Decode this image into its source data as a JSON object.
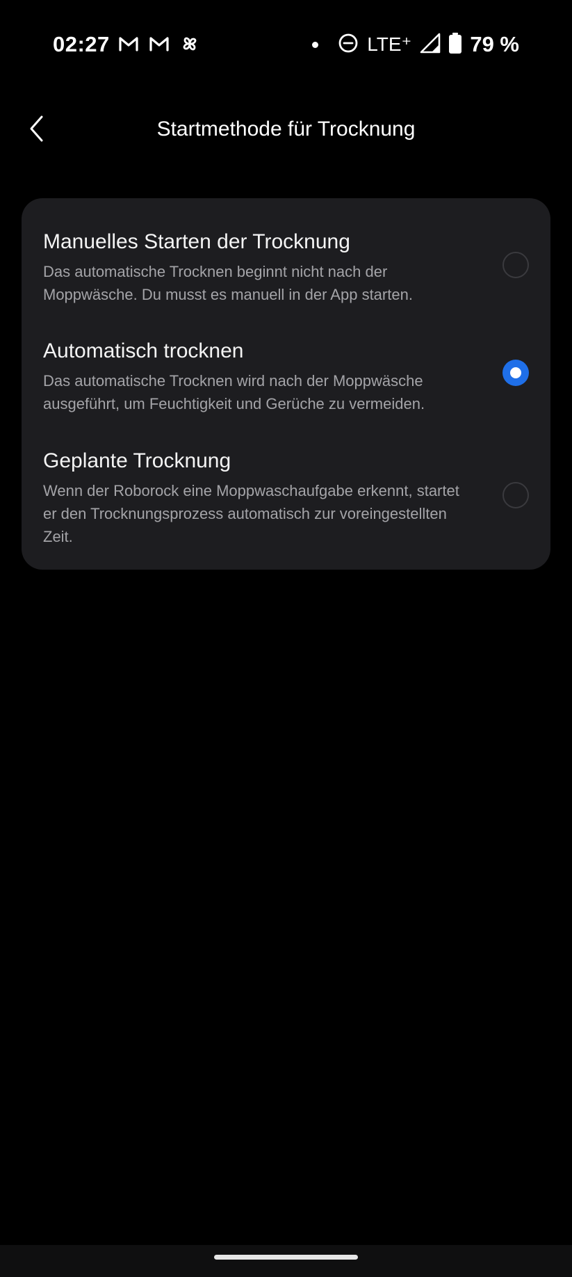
{
  "status_bar": {
    "time": "02:27",
    "lte": "LTE⁺",
    "battery": "79 %",
    "left_icons": [
      "gmail-icon",
      "gmail-icon",
      "pinwheel-icon"
    ],
    "right_icons": [
      "notification-dot-icon",
      "do-not-disturb-icon",
      "signal-icon",
      "battery-icon"
    ]
  },
  "header": {
    "title": "Startmethode für Trocknung",
    "back_icon": "chevron-left-icon"
  },
  "options": [
    {
      "title": "Manuelles Starten der Trocknung",
      "description": "Das automatische Trocknen beginnt nicht nach der Moppwäsche. Du musst es manuell in der App starten.",
      "selected": false
    },
    {
      "title": "Automatisch trocknen",
      "description": "Das automatische Trocknen wird nach der Moppwäsche ausgeführt, um Feuchtigkeit und Gerüche zu vermeiden.",
      "selected": true
    },
    {
      "title": "Geplante Trocknung",
      "description": "Wenn der Roborock eine Moppwaschaufgabe erkennt, startet er den Trocknungsprozess automatisch zur voreingestellten Zeit.",
      "selected": false
    }
  ],
  "colors": {
    "background": "#000000",
    "card": "#1d1d20",
    "accent": "#1f6fe8",
    "description": "#a4a4a8"
  }
}
